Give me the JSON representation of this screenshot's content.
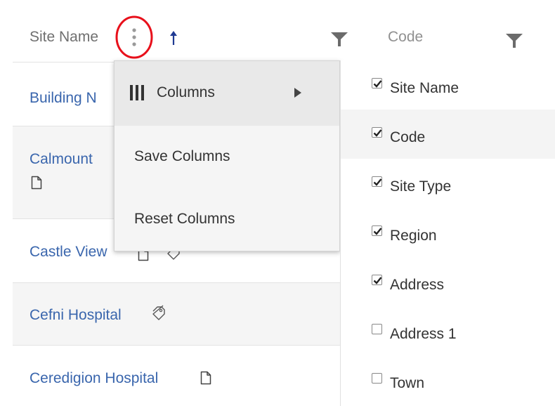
{
  "header": {
    "site_name_label": "Site Name",
    "code_label": "Code"
  },
  "rows": [
    {
      "name": "Building N"
    },
    {
      "name": "Calmount"
    },
    {
      "name": "Castle View"
    },
    {
      "name": "Cefni Hospital"
    },
    {
      "name": "Ceredigion Hospital"
    }
  ],
  "menu": {
    "columns_label": "Columns",
    "save_label": "Save Columns",
    "reset_label": "Reset Columns"
  },
  "columns_submenu": [
    {
      "label": "Site Name",
      "checked": true
    },
    {
      "label": "Code",
      "checked": true
    },
    {
      "label": "Site Type",
      "checked": true
    },
    {
      "label": "Region",
      "checked": true
    },
    {
      "label": "Address",
      "checked": true
    },
    {
      "label": "Address 1",
      "checked": false
    },
    {
      "label": "Town",
      "checked": false
    }
  ],
  "colors": {
    "link": "#3a66ad",
    "highlight_circle": "#e8101b",
    "sort_arrow": "#1f3a93"
  },
  "icons": {
    "kebab": "vertical-dots-icon",
    "sort": "arrow-up-icon",
    "filter": "funnel-icon",
    "columns": "columns-icon",
    "submenu": "triangle-right-icon",
    "document": "document-icon",
    "tag": "tag-icon"
  }
}
